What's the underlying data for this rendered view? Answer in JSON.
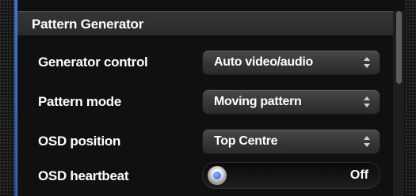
{
  "panel": {
    "title": "Pattern Generator"
  },
  "rows": [
    {
      "label": "Generator control",
      "value": "Auto video/audio"
    },
    {
      "label": "Pattern mode",
      "value": "Moving pattern"
    },
    {
      "label": "OSD position",
      "value": "Top Centre"
    }
  ],
  "heartbeat": {
    "label": "OSD heartbeat",
    "state": "Off"
  },
  "colors": {
    "accent": "#3f6fc4",
    "knob_dot": "#2c5dd0"
  },
  "icons": {
    "select_arrow": "updown-arrow-icon",
    "toggle_knob": "toggle-knob-icon"
  }
}
